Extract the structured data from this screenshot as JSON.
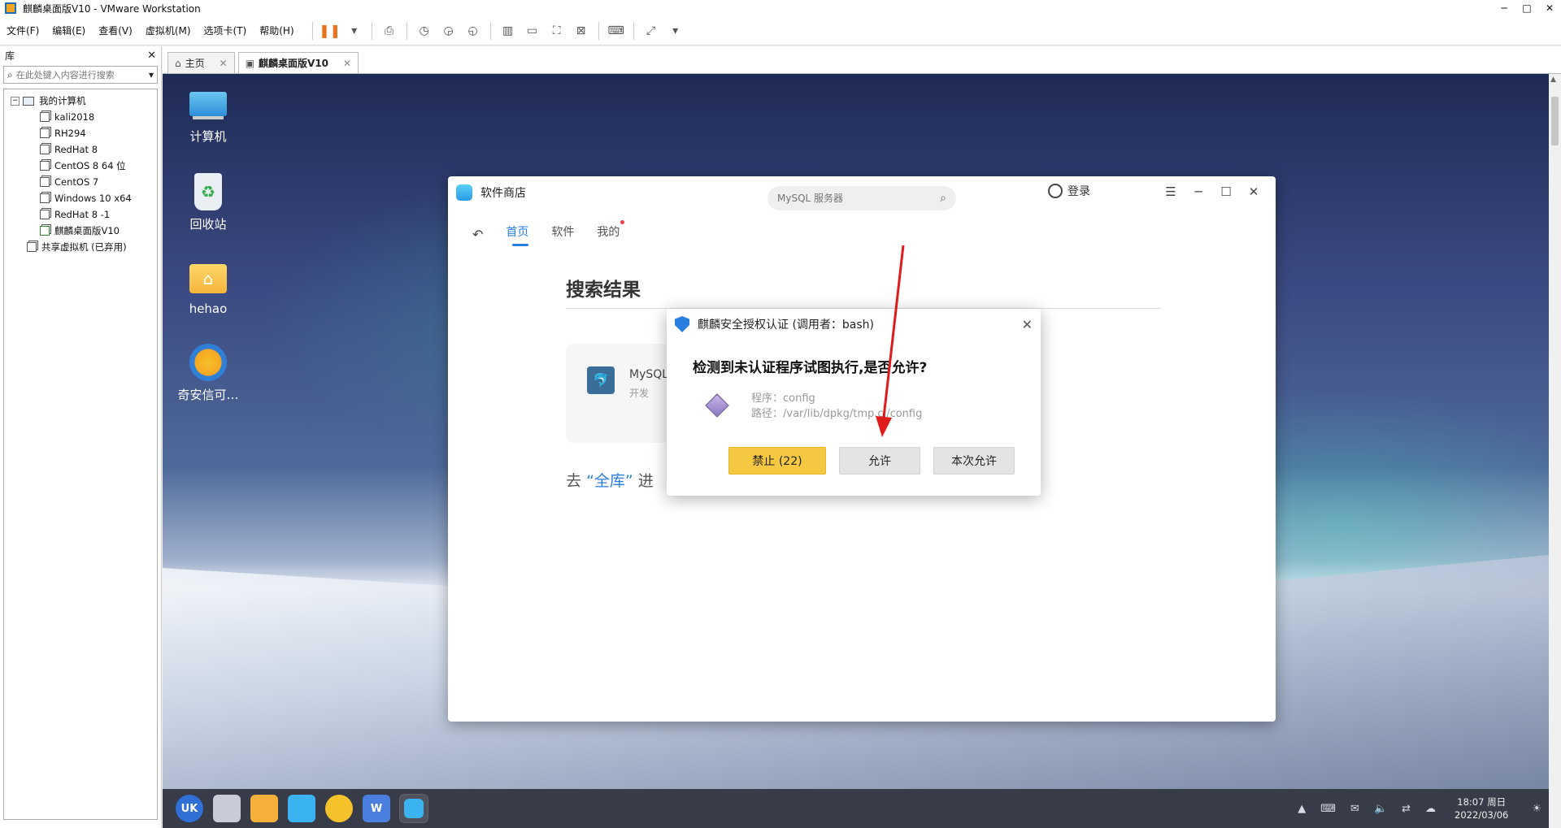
{
  "window": {
    "title": "麒麟桌面版V10 - VMware Workstation",
    "minimize": "─",
    "maximize": "□",
    "close": "✕"
  },
  "menu": [
    "文件(F)",
    "编辑(E)",
    "查看(V)",
    "虚拟机(M)",
    "选项卡(T)",
    "帮助(H)"
  ],
  "library": {
    "title": "库",
    "close": "✕",
    "search_placeholder": "在此处键入内容进行搜索",
    "root": "我的计算机",
    "vms": [
      "kali2018",
      "RH294",
      "RedHat 8",
      "CentOS 8 64 位",
      "CentOS 7",
      "Windows 10 x64",
      "RedHat 8 -1",
      "麒麟桌面版V10"
    ],
    "shared": "共享虚拟机 (已弃用)"
  },
  "tabs": [
    {
      "label": "主页",
      "icon": "home-icon"
    },
    {
      "label": "麒麟桌面版V10",
      "icon": "vm-icon"
    }
  ],
  "desktop_icons": [
    "计算机",
    "回收站",
    "hehao",
    "奇安信可…"
  ],
  "store": {
    "title": "软件商店",
    "search_placeholder": "MySQL 服务器",
    "login": "登录",
    "nav": [
      "首页",
      "软件",
      "我的"
    ],
    "heading": "搜索结果",
    "app_name": "MySQL",
    "app_category": "开发",
    "footer_prefix": "去",
    "footer_link": "“全库”",
    "footer_suffix": "进"
  },
  "auth_dialog": {
    "title": "麒麟安全授权认证 (调用者：bash)",
    "question": "检测到未认证程序试图执行,是否允许?",
    "program_line": "程序：config",
    "path_line": "路径：/var/lib/dpkg/tmp.ci/config",
    "deny_label": "禁止 (22)",
    "allow_label": "允许",
    "allow_once_label": "本次允许",
    "accent_color": "#f5c842"
  },
  "taskbar": {
    "uk_label": "UK",
    "wps_label": "W",
    "clock_time": "18:07 周日",
    "clock_date": "2022/03/06"
  }
}
